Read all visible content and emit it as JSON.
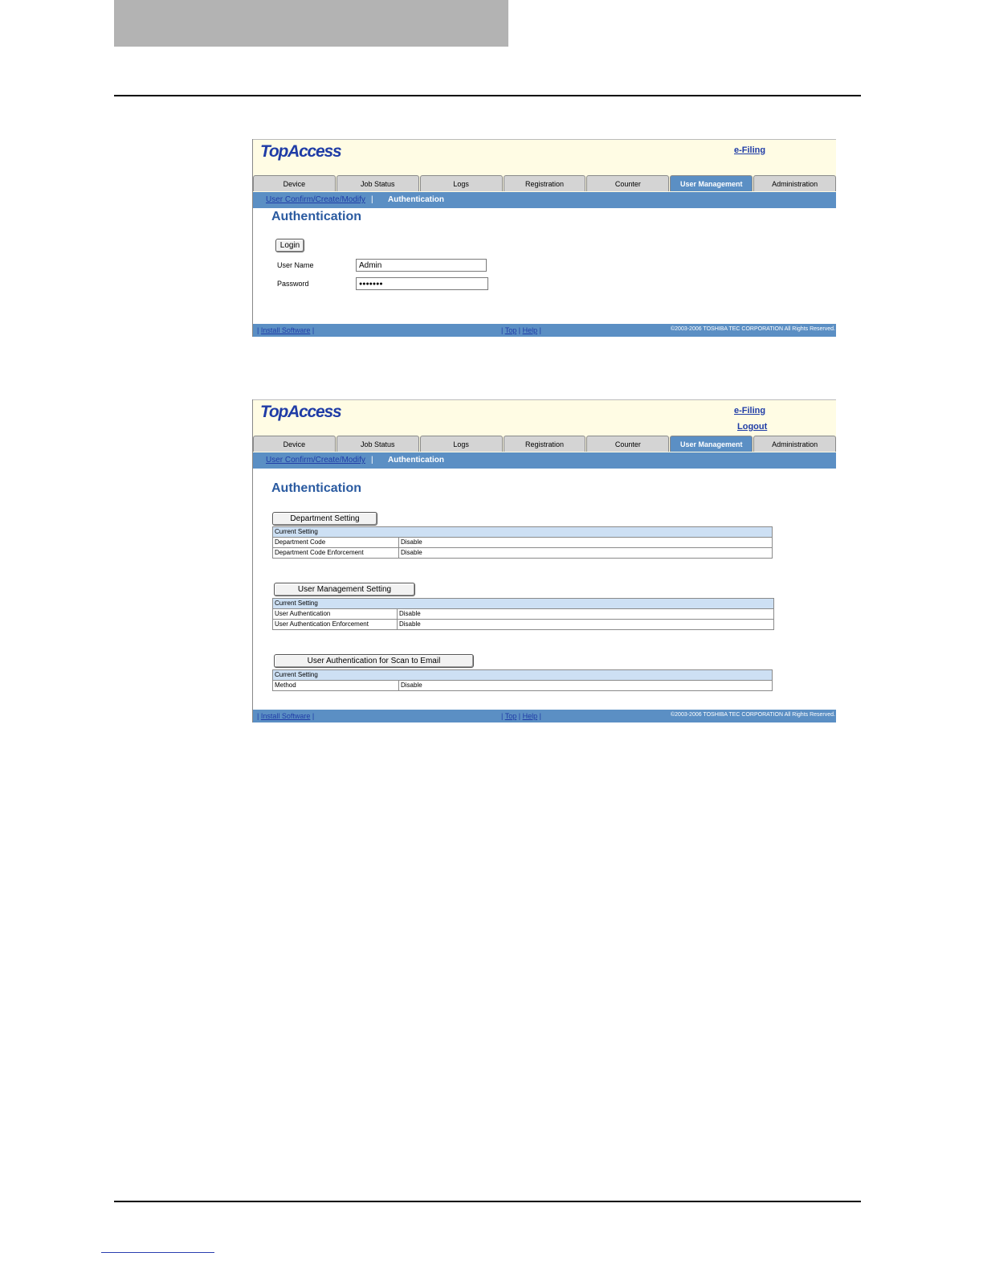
{
  "app": {
    "logo": "TopAccess",
    "efiling_link": "e-Filing",
    "logout_link": "Logout",
    "tabs": [
      "Device",
      "Job Status",
      "Logs",
      "Registration",
      "Counter",
      "User Management",
      "Administration"
    ],
    "active_tab": "User Management",
    "subnav": {
      "link": "User Confirm/Create/Modify",
      "separator": "|",
      "current": "Authentication"
    },
    "page_title": "Authentication",
    "footer": {
      "install_software": "Install Software",
      "top": "Top",
      "help": "Help",
      "bar": "|",
      "copyright": "©2003-2006 TOSHIBA TEC CORPORATION All Rights Reserved."
    }
  },
  "login_screen": {
    "login_button": "Login",
    "username_label": "User Name",
    "username_value": "Admin",
    "password_label": "Password",
    "password_value": "●●●●●●●"
  },
  "settings_screen": {
    "sections": [
      {
        "button": "Department Setting",
        "header": "Current Setting",
        "rows": [
          {
            "label": "Department Code",
            "value": "Disable"
          },
          {
            "label": "Department Code Enforcement",
            "value": "Disable"
          }
        ]
      },
      {
        "button": "User Management Setting",
        "header": "Current Setting",
        "rows": [
          {
            "label": "User Authentication",
            "value": "Disable"
          },
          {
            "label": "User Authentication Enforcement",
            "value": "Disable"
          }
        ]
      },
      {
        "button": "User Authentication for Scan to Email",
        "header": "Current Setting",
        "rows": [
          {
            "label": "Method",
            "value": "Disable"
          }
        ]
      }
    ]
  }
}
